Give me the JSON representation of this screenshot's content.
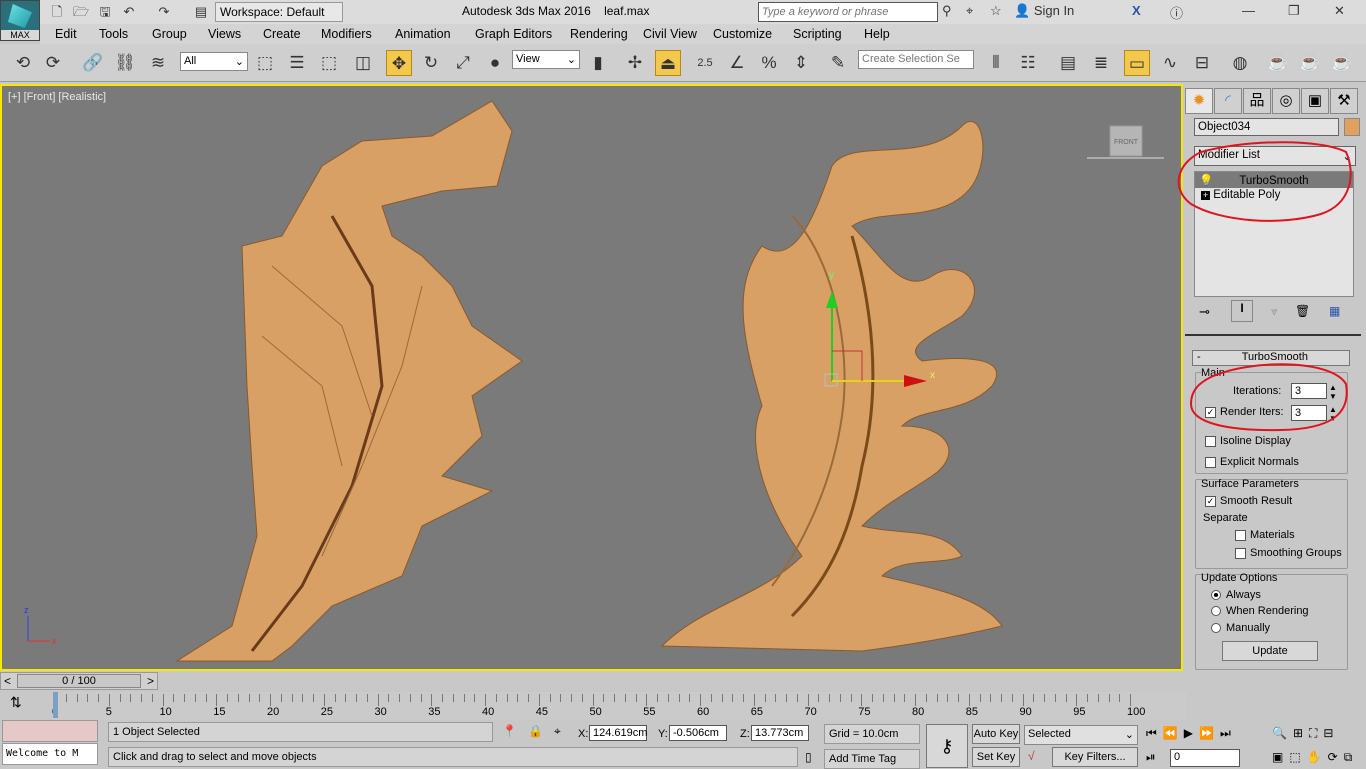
{
  "titlebar": {
    "logo_text": "MAX",
    "workspace": "Workspace: Default",
    "app_title": "Autodesk 3ds Max 2016",
    "file": "leaf.max",
    "search_placeholder": "Type a keyword or phrase",
    "sign_in": "Sign In"
  },
  "menu": [
    "Edit",
    "Tools",
    "Group",
    "Views",
    "Create",
    "Modifiers",
    "Animation",
    "Graph Editors",
    "Rendering",
    "Civil View",
    "Customize",
    "Scripting",
    "Help"
  ],
  "toolbar": {
    "filter": "All",
    "ref_coord": "View",
    "snap_value": "2.5",
    "selection_set_placeholder": "Create Selection Se"
  },
  "viewport": {
    "label": "[+] [Front] [Realistic]",
    "viewcube": "FRONT",
    "gizmo_x": "x",
    "gizmo_y": "y",
    "axis_z": "z",
    "axis_x": "x",
    "object_color": "#d9a066"
  },
  "command_panel": {
    "object_name": "Object034",
    "object_color": "#e0a060",
    "modifier_list": "Modifier List",
    "stack": [
      "TurboSmooth",
      "Editable Poly"
    ],
    "rollout_title": "TurboSmooth",
    "main_label": "Main",
    "iterations_label": "Iterations:",
    "iterations": "3",
    "render_iters_label": "Render Iters:",
    "render_iters": "3",
    "render_iters_checked": true,
    "isoline": "Isoline Display",
    "explicit_normals": "Explicit Normals",
    "surface_label": "Surface Parameters",
    "smooth_result": "Smooth Result",
    "separate_label": "Separate",
    "materials": "Materials",
    "smoothing_groups": "Smoothing Groups",
    "update_label": "Update Options",
    "always": "Always",
    "when_rendering": "When Rendering",
    "manually": "Manually",
    "update_button": "Update",
    "annotation_color": "#e0141e"
  },
  "timeline": {
    "frame": "0 / 100",
    "ticks": [
      "0",
      "5",
      "10",
      "15",
      "20",
      "25",
      "30",
      "35",
      "40",
      "45",
      "50",
      "55",
      "60",
      "65",
      "70",
      "75",
      "80",
      "85",
      "90",
      "95",
      "100"
    ]
  },
  "status": {
    "listener": "Welcome to M",
    "selected": "1 Object Selected",
    "prompt": "Click and drag to select and move objects",
    "x_label": "X:",
    "x": "124.619cm",
    "y_label": "Y:",
    "y": "-0.506cm",
    "z_label": "Z:",
    "z": "13.773cm",
    "grid": "Grid = 10.0cm",
    "add_time_tag": "Add Time Tag",
    "auto_key": "Auto Key",
    "set_key": "Set Key",
    "key_mode": "Selected",
    "key_filters": "Key Filters...",
    "current_frame": "0"
  }
}
